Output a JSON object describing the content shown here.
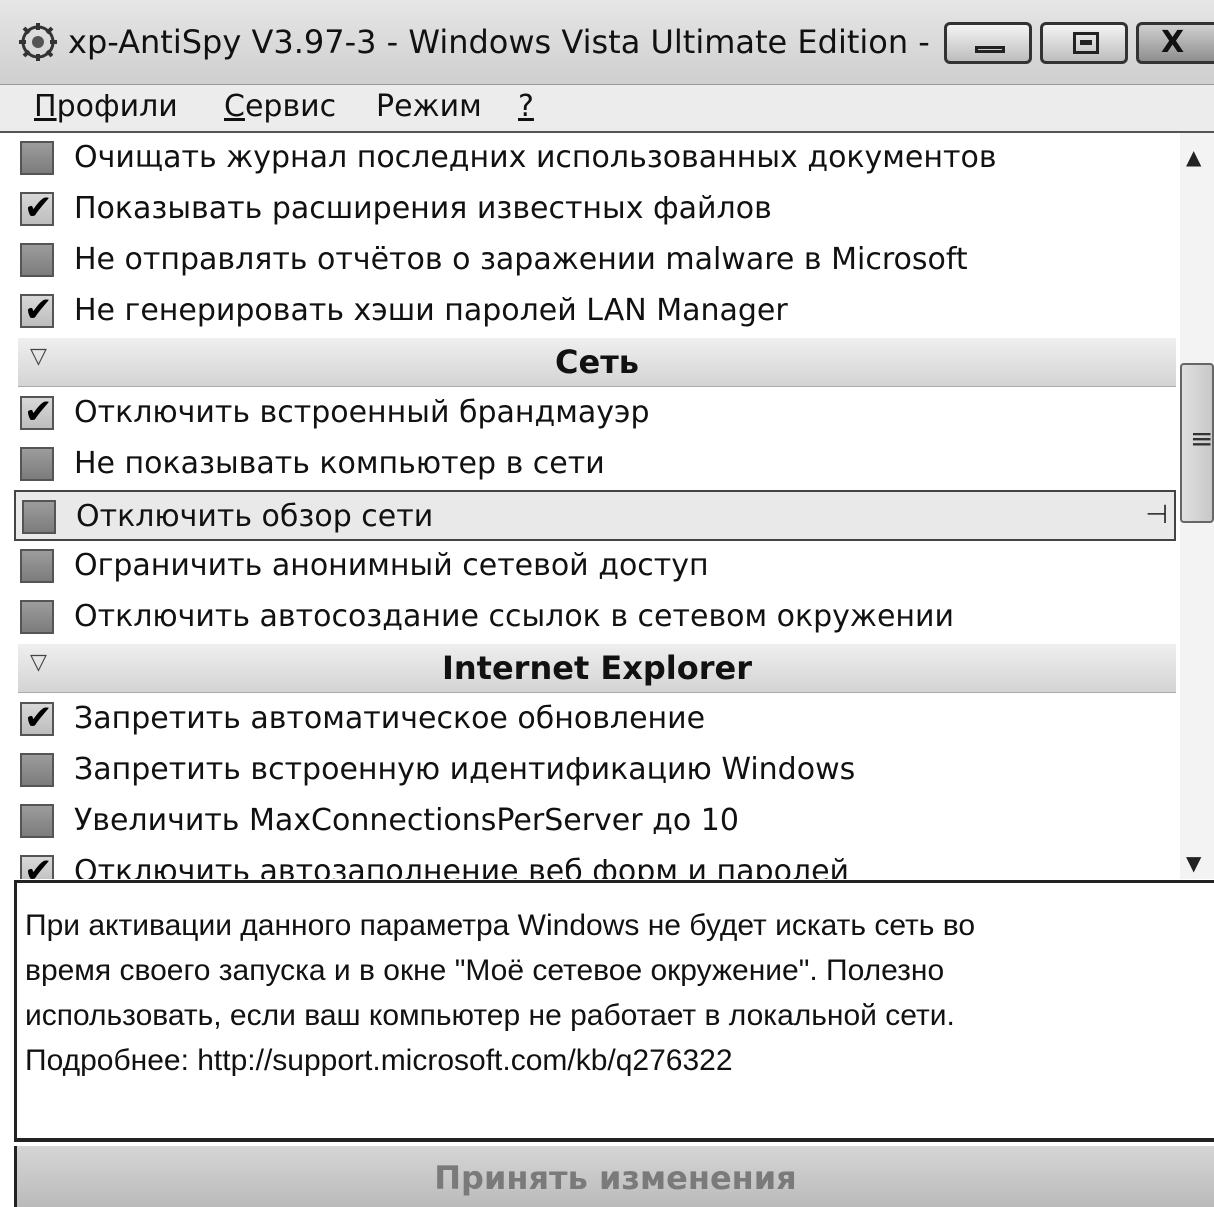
{
  "window": {
    "title": "xp-AntiSpy V3.97-3 - Windows Vista Ultimate Edition -",
    "icon": "app-icon",
    "buttons": {
      "minimize": "minimize-icon",
      "maximize": "maximize-icon",
      "close": "X"
    }
  },
  "menu": {
    "items": [
      {
        "accel": "П",
        "rest": "рофили"
      },
      {
        "accel": "С",
        "rest": "ервис"
      },
      {
        "accel": "",
        "rest": "Режим"
      },
      {
        "accel": "?",
        "rest": ""
      }
    ]
  },
  "list": {
    "rows": [
      {
        "type": "item",
        "label": "Очищать журнал последних использованных документов",
        "checked": false
      },
      {
        "type": "item",
        "label": "Показывать расширения известных файлов",
        "checked": true
      },
      {
        "type": "item",
        "label": "Не отправлять отчётов о заражении malware в Microsoft",
        "checked": false
      },
      {
        "type": "item",
        "label": "Не генерировать хэши паролей LAN Manager",
        "checked": true
      },
      {
        "type": "group",
        "label": "Сеть"
      },
      {
        "type": "item",
        "label": "Отключить встроенный брандмауэр",
        "checked": true
      },
      {
        "type": "item",
        "label": "Не показывать компьютер в сети",
        "checked": false
      },
      {
        "type": "item",
        "label": "Отключить обзор сети",
        "checked": false,
        "selected": true
      },
      {
        "type": "item",
        "label": "Ограничить анонимный сетевой доступ",
        "checked": false
      },
      {
        "type": "item",
        "label": "Отключить автосоздание ссылок в сетевом окружении",
        "checked": false
      },
      {
        "type": "group",
        "label": "Internet Explorer"
      },
      {
        "type": "item",
        "label": "Запретить автоматическое обновление",
        "checked": true
      },
      {
        "type": "item",
        "label": "Запретить встроенную идентификацию Windows",
        "checked": false
      },
      {
        "type": "item",
        "label": "Увеличить MaxConnectionsPerServer до 10",
        "checked": false
      },
      {
        "type": "item",
        "label": "Отключить автозаполнение веб форм и паролей",
        "checked": true
      }
    ],
    "check_mark": "✔",
    "group_arrow": "▽"
  },
  "scrollbar": {
    "up": "▲",
    "down": "▼",
    "grip": "≡"
  },
  "description": {
    "lines": [
      "При активации данного параметра Windows не будет искать сеть во",
      "время своего запуска и в окне \"Моё сетевое окружение\". Полезно",
      "использовать, если ваш компьютер не работает в локальной сети.",
      "Подробнее: http://support.microsoft.com/kb/q276322"
    ]
  },
  "apply_button": {
    "label": "Принять изменения",
    "enabled": false
  }
}
